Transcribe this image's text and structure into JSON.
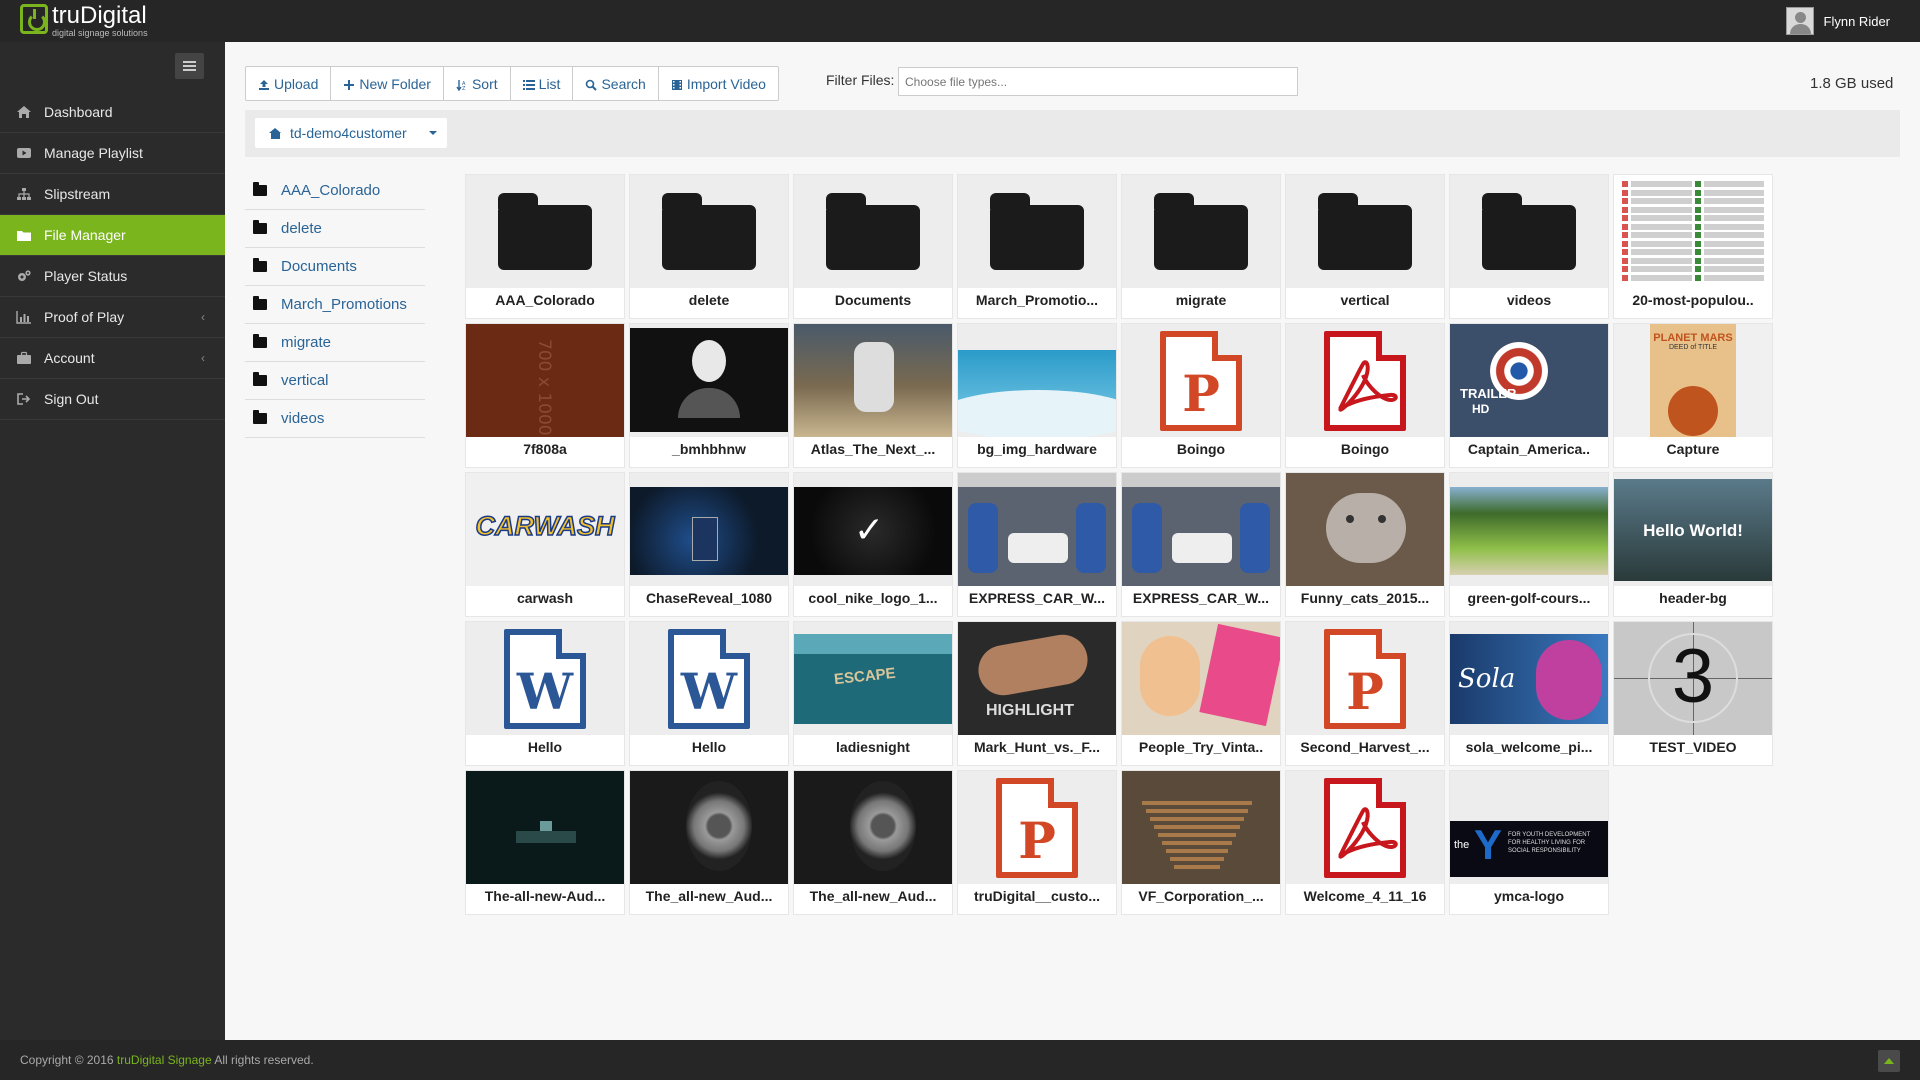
{
  "header": {
    "logo_name": "truDigital",
    "logo_tagline": "digital signage solutions",
    "user_name": "Flynn Rider"
  },
  "sidebar": {
    "items": [
      {
        "label": "Dashboard",
        "icon": "home-icon",
        "active": false,
        "arrow": false
      },
      {
        "label": "Manage Playlist",
        "icon": "play-icon",
        "active": false,
        "arrow": false
      },
      {
        "label": "Slipstream",
        "icon": "sitemap-icon",
        "active": false,
        "arrow": false
      },
      {
        "label": "File Manager",
        "icon": "folder-icon",
        "active": true,
        "arrow": false
      },
      {
        "label": "Player Status",
        "icon": "cogs-icon",
        "active": false,
        "arrow": false
      },
      {
        "label": "Proof of Play",
        "icon": "bar-chart-icon",
        "active": false,
        "arrow": true
      },
      {
        "label": "Account",
        "icon": "briefcase-icon",
        "active": false,
        "arrow": true
      },
      {
        "label": "Sign Out",
        "icon": "sign-out-icon",
        "active": false,
        "arrow": false
      }
    ]
  },
  "toolbar": {
    "upload": "Upload",
    "new_folder": "New Folder",
    "sort": "Sort",
    "list": "List",
    "search": "Search",
    "import_video": "Import Video",
    "filter_label": "Filter Files:",
    "filter_placeholder": "Choose file types...",
    "usage": "1.8 GB used"
  },
  "breadcrumb": {
    "current": "td-demo4customer"
  },
  "folder_tree": [
    "AAA_Colorado",
    "delete",
    "Documents",
    "March_Promotions",
    "migrate",
    "vertical",
    "videos"
  ],
  "files": [
    {
      "label": "AAA_Colorado",
      "kind": "folder"
    },
    {
      "label": "delete",
      "kind": "folder"
    },
    {
      "label": "Documents",
      "kind": "folder"
    },
    {
      "label": "March_Promotio...",
      "kind": "folder"
    },
    {
      "label": "migrate",
      "kind": "folder"
    },
    {
      "label": "vertical",
      "kind": "folder"
    },
    {
      "label": "videos",
      "kind": "folder"
    },
    {
      "label": "20-most-populou..",
      "kind": "image",
      "bg": "#ffffff",
      "fg": "#d9534f"
    },
    {
      "label": "7f808a",
      "kind": "image",
      "bg": "#6b2a14",
      "fg": "#8a4a36"
    },
    {
      "label": "_bmhbhnw",
      "kind": "image",
      "bg": "#111111",
      "fg": "#555555"
    },
    {
      "label": "Atlas_The_Next_...",
      "kind": "image",
      "bg": "#7a6a50",
      "fg": "#c9b690"
    },
    {
      "label": "bg_img_hardware",
      "kind": "image",
      "bg": "#2a9bc9",
      "fg": "#e6f3f8"
    },
    {
      "label": "Boingo",
      "kind": "ppt"
    },
    {
      "label": "Boingo",
      "kind": "pdf"
    },
    {
      "label": "Captain_America..",
      "kind": "image",
      "bg": "#3b4f6b",
      "fg": "#c0392b"
    },
    {
      "label": "Capture",
      "kind": "image",
      "bg": "#e8c08a",
      "fg": "#c0541e"
    },
    {
      "label": "carwash",
      "kind": "image",
      "bg": "#f0f0f0",
      "fg": "#f2c12e"
    },
    {
      "label": "ChaseReveal_1080",
      "kind": "image",
      "bg": "#0d1a2a",
      "fg": "#1f4e8c"
    },
    {
      "label": "cool_nike_logo_1...",
      "kind": "image",
      "bg": "#0a0a0a",
      "fg": "#ffffff"
    },
    {
      "label": "EXPRESS_CAR_W...",
      "kind": "image",
      "bg": "#5c6370",
      "fg": "#2e5aa8"
    },
    {
      "label": "EXPRESS_CAR_W...",
      "kind": "image",
      "bg": "#5c6370",
      "fg": "#2e5aa8"
    },
    {
      "label": "Funny_cats_2015...",
      "kind": "image",
      "bg": "#6b5a4a",
      "fg": "#b8b0a8"
    },
    {
      "label": "green-golf-cours...",
      "kind": "image",
      "bg": "#3e6b2a",
      "fg": "#8fbf4a"
    },
    {
      "label": "header-bg",
      "kind": "image",
      "bg": "#2a3a3a",
      "fg": "#ffffff"
    },
    {
      "label": "Hello",
      "kind": "word"
    },
    {
      "label": "Hello",
      "kind": "word"
    },
    {
      "label": "ladiesnight",
      "kind": "image",
      "bg": "#1f6a78",
      "fg": "#d8c59a"
    },
    {
      "label": "Mark_Hunt_vs._F...",
      "kind": "image",
      "bg": "#2a2a2a",
      "fg": "#b08060"
    },
    {
      "label": "People_Try_Vinta..",
      "kind": "image",
      "bg": "#e0d4c0",
      "fg": "#e84a8a"
    },
    {
      "label": "Second_Harvest_...",
      "kind": "ppt"
    },
    {
      "label": "sola_welcome_pi...",
      "kind": "image",
      "bg": "#1a3a6a",
      "fg": "#c040a0"
    },
    {
      "label": "TEST_VIDEO",
      "kind": "image",
      "bg": "#c8c8c8",
      "fg": "#111111"
    },
    {
      "label": "The-all-new-Aud...",
      "kind": "image",
      "bg": "#0a1a1a",
      "fg": "#2a4a4a"
    },
    {
      "label": "The_all-new_Aud...",
      "kind": "image",
      "bg": "#1a1a1a",
      "fg": "#9a9a9a"
    },
    {
      "label": "The_all-new_Aud...",
      "kind": "image",
      "bg": "#1a1a1a",
      "fg": "#9a9a9a"
    },
    {
      "label": "truDigital__custo...",
      "kind": "ppt"
    },
    {
      "label": "VF_Corporation_...",
      "kind": "image",
      "bg": "#5a4a3a",
      "fg": "#a87a4a"
    },
    {
      "label": "Welcome_4_11_16",
      "kind": "pdf"
    },
    {
      "label": "ymca-logo",
      "kind": "image",
      "bg": "#0a0a14",
      "fg": "#1e6ac8"
    }
  ],
  "overlays": {
    "thumb_7f808a": "700 x 1000",
    "thumb_captain_tag": "TRAILER",
    "thumb_captain_hd": "HD",
    "thumb_carwash": "CARWASH",
    "thumb_nike": "✓",
    "thumb_hello_world": "Hello World!",
    "thumb_escape": "ESCAPE",
    "thumb_highlight": "HIGHLIGHT",
    "thumb_sola": "Sola",
    "thumb_test_video": "3",
    "thumb_capture_title": "PLANET MARS",
    "thumb_capture_sub": "DEED of TITLE",
    "thumb_ymca_the": "the",
    "thumb_ymca_y": "Y",
    "thumb_ymca_text": "FOR YOUTH DEVELOPMENT FOR HEALTHY LIVING FOR SOCIAL RESPONSIBILITY"
  },
  "footer": {
    "prefix": "Copyright © 2016 ",
    "link": "truDigital Signage",
    "suffix": " All rights reserved."
  },
  "colors": {
    "accent": "#7ab51d",
    "topbar": "#262626",
    "sidebar": "#2b2b2b",
    "link": "#2a6496"
  }
}
